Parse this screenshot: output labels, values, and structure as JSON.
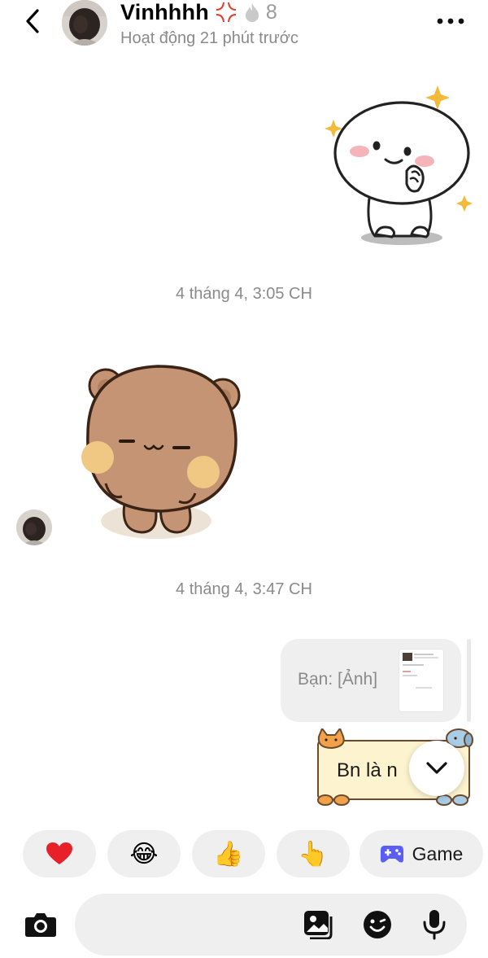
{
  "header": {
    "name": "Vinhhhh",
    "streak_count": "8",
    "status": "Hoạt động 21 phút trước",
    "icons": [
      "back-chevron-icon",
      "anger-symbol-icon",
      "flame-icon",
      "more-dots-icon"
    ]
  },
  "messages": {
    "timestamp_1": "4 tháng 4, 3:05 CH",
    "timestamp_2": "4 tháng 4, 3:47 CH",
    "reply_preview_text": "Bạn: [Ảnh]",
    "note_card_text": "Bn là n"
  },
  "quick_reactions": {
    "heart": "❤️",
    "laugh": "😂",
    "thumbs_up": "👍",
    "point": "👆",
    "game_label": "Game"
  },
  "composer": {
    "placeholder": ""
  },
  "colors": {
    "bubble_gray": "#efefef",
    "text_gray": "#8a8a8a",
    "game_icon_blue": "#5b5ef4",
    "heart_red": "#e8202a"
  }
}
